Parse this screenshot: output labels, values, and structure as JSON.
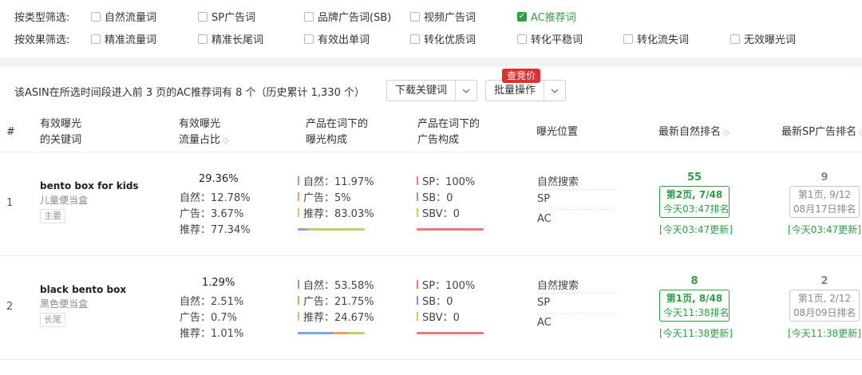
{
  "colors": {
    "accent_green": "#2f9e44",
    "badge_red": "#e03131",
    "natural": "#7aa6d8",
    "ad": "#f0a15c",
    "recommend": "#b5d36c",
    "sp": "#e87b7b",
    "sb": "#8f8fd8",
    "sbv": "#e8c25a"
  },
  "filters": {
    "type_label": "按类型筛选:",
    "type_options": [
      {
        "label": "自然流量词",
        "checked": false
      },
      {
        "label": "SP广告词",
        "checked": false
      },
      {
        "label": "品牌广告词(SB)",
        "checked": false
      },
      {
        "label": "视频广告词",
        "checked": false
      },
      {
        "label": "AC推荐词",
        "checked": true
      }
    ],
    "effect_label": "按效果筛选:",
    "effect_options": [
      {
        "label": "精准流量词",
        "checked": false
      },
      {
        "label": "精准长尾词",
        "checked": false
      },
      {
        "label": "有效出单词",
        "checked": false
      },
      {
        "label": "转化优质词",
        "checked": false
      },
      {
        "label": "转化平稳词",
        "checked": false
      },
      {
        "label": "转化流失词",
        "checked": false
      },
      {
        "label": "无效曝光词",
        "checked": false
      }
    ]
  },
  "summary": {
    "text": "该ASIN在所选时间段进入前 3 页的AC推荐词有 8 个（历史累计 1,330 个）",
    "download_label": "下载关键词",
    "batch_label": "批量操作",
    "badge": "查竞价",
    "dropdown_icon": "chevron-down-icon"
  },
  "table": {
    "headers": {
      "index": "#",
      "keyword_line1": "有效曝光",
      "keyword_line2": "的关键词",
      "share_line1": "有效曝光",
      "share_line2": "流量占比",
      "exposure_line1": "产品在词下的",
      "exposure_line2": "曝光构成",
      "ad_line1": "产品在词下的",
      "ad_line2": "广告构成",
      "position": "曝光位置",
      "natural_rank": "最新自然排名",
      "sp_rank": "最新SP广告排名"
    },
    "rows": [
      {
        "index": "1",
        "keyword": "bento box for kids",
        "keyword_cn": "儿童便当盒",
        "tag": "主要",
        "share": "29.36%",
        "share_natural": "自然：12.78%",
        "share_ad": "广告：3.67%",
        "share_rec": "推荐：77.34%",
        "exp_natural": "自然：11.97%",
        "exp_ad": "广告：5%",
        "exp_rec": "推荐：83.03%",
        "exp_bar": [
          11.97,
          5,
          83.03
        ],
        "ad_sp": "SP：100%",
        "ad_sb": "SB：0",
        "ad_sbv": "SBV：0",
        "ad_bar": [
          100,
          0,
          0
        ],
        "pos": [
          "自然搜索",
          "SP",
          "AC"
        ],
        "natural_rank": "55",
        "natural_page": "第2页, 7/48",
        "natural_time": "今天03:47排名",
        "natural_update": "[今天03:47更新]",
        "sp_rank": "9",
        "sp_page": "第1页, 9/12",
        "sp_time": "08月17日排名",
        "sp_update": "[今天03:47更新]"
      },
      {
        "index": "2",
        "keyword": "black bento box",
        "keyword_cn": "黑色便当盒",
        "tag": "长尾",
        "share": "1.29%",
        "share_natural": "自然：2.51%",
        "share_ad": "广告：0.7%",
        "share_rec": "推荐：1.01%",
        "exp_natural": "自然：53.58%",
        "exp_ad": "广告：21.75%",
        "exp_rec": "推荐：24.67%",
        "exp_bar": [
          53.58,
          21.75,
          24.67
        ],
        "ad_sp": "SP：100%",
        "ad_sb": "SB：0",
        "ad_sbv": "SBV：0",
        "ad_bar": [
          100,
          0,
          0
        ],
        "pos": [
          "自然搜索",
          "SP",
          "AC"
        ],
        "natural_rank": "8",
        "natural_page": "第1页, 8/48",
        "natural_time": "今天11:38排名",
        "natural_update": "[今天11:38更新]",
        "sp_rank": "2",
        "sp_page": "第1页, 2/12",
        "sp_time": "08月09日排名",
        "sp_update": "[今天11:38更新]"
      }
    ]
  }
}
